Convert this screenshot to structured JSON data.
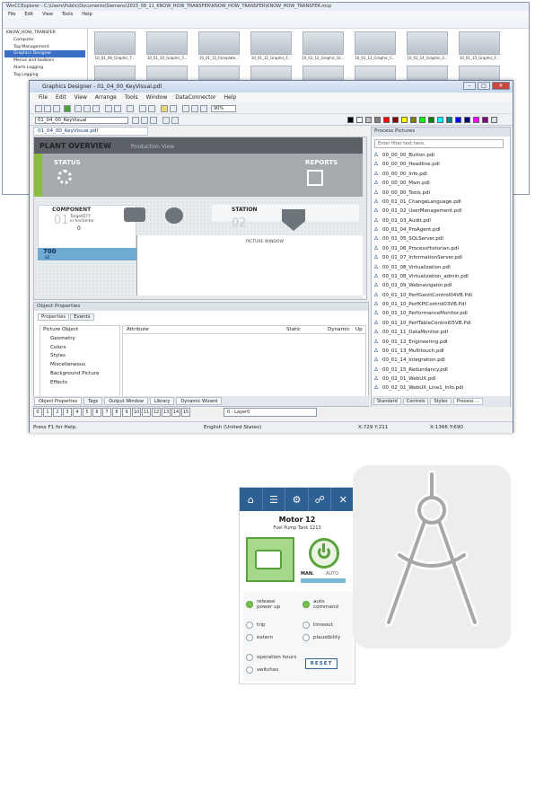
{
  "explorer": {
    "title": "WinCCExplorer - C:\\Users\\Public\\Documents\\Siemens\\2015_08_11_KNOW_HOW_TRANSFER\\KNOW_HOW_TRANSFER\\KNOW_HOW_TRANSFER.mcp",
    "menu": [
      "File",
      "Edit",
      "View",
      "Tools",
      "Help"
    ],
    "tree": [
      "KNOW_HOW_TRANSFER",
      "Computer",
      "Tag Management",
      "Graphics Designer",
      "Menus and toolbars",
      "Alarm Logging",
      "Tag Logging"
    ],
    "thumbs": [
      "10_01_09_Graphic_T...",
      "10_01_10_Graphic_F...",
      "10_01_11_Faceplate...",
      "10_01_11_Graphic_F...",
      "10_01_12_Graphic_Sc...",
      "10_01_13_Graphic_C...",
      "10_01_14_Graphic_3...",
      "10_01_15_Graphic_F..."
    ]
  },
  "designer": {
    "title": "Graphics Designer - 01_04_00_KeyVisual.pdl",
    "menu": [
      "File",
      "Edit",
      "View",
      "Arrange",
      "Tools",
      "Window",
      "DataConnector",
      "Help"
    ],
    "zoom": "90%",
    "object_name": "01_04_00_KeyVisual",
    "doc_tab": "01_04_00_KeyVisual.pdl",
    "swatch_colors": [
      "#000000",
      "#ffffff",
      "#c0c0c0",
      "#808080",
      "#ff0000",
      "#800000",
      "#ffff00",
      "#808000",
      "#00ff00",
      "#008000",
      "#00ffff",
      "#008080",
      "#0000ff",
      "#000080",
      "#ff00ff",
      "#800080",
      "#e0e0e0"
    ],
    "hmi": {
      "title": "PLANT OVERVIEW",
      "subtitle": "Production View",
      "status": "STATUS",
      "reports": "REPORTS",
      "component": "COMPONENT",
      "component_num": "01",
      "target_label_1": "TargetQTY",
      "target_label_2": "in hectoliter",
      "target_value": "0",
      "station": "STATION",
      "station_num": "02",
      "picture_window": "PICTURE WINDOW",
      "level_value": "700",
      "level_unit": "kB"
    },
    "process_pictures": {
      "title": "Process Pictures",
      "filter_placeholder": "Enter filter text here.",
      "items": [
        "00_00_00_Button.pdl",
        "00_00_00_Headline.pdl",
        "00_00_00_Info.pdl",
        "00_00_00_Main.pdl",
        "00_00_00_Tools.pdl",
        "00_01_01_ChangeLanguage.pdl",
        "00_01_02_UserManagement.pdl",
        "00_01_03_Audit.pdl",
        "00_01_04_ProAgent.pdl",
        "00_01_05_SQLServer.pdl",
        "00_01_06_ProcessHistorian.pdl",
        "00_01_07_InformationServer.pdl",
        "00_01_08_Virtualization.pdl",
        "00_01_08_Virtualization_admin.pdl",
        "00_01_09_Webnavigator.pdl",
        "00_01_10_PerfGanttControl04VB.Pdl",
        "00_01_10_PerfKPIControl03VB.Pdl",
        "00_01_10_PerformanceMonitor.pdl",
        "00_01_10_PerfTableControl05VB.Pdl",
        "00_01_11_DataMonitor.pdl",
        "00_01_12_Engineering.pdl",
        "00_01_13_Multitouch.pdl",
        "00_01_14_Integration.pdl",
        "00_01_15_Redundancy.pdl",
        "00_02_01_WebUX.pdl",
        "00_02_01_WebUX_Line1_Info.pdl"
      ],
      "tabs": [
        "Standard",
        "Controls",
        "Styles",
        "Process ..."
      ]
    },
    "object_properties": {
      "title": "Object Properties",
      "tabs": [
        "Properties",
        "Events"
      ],
      "root": "Picture Object",
      "children": [
        "Geometry",
        "Colors",
        "Styles",
        "Miscellaneous",
        "Background Picture",
        "Effects"
      ],
      "columns": [
        "Attribute",
        "Static",
        "Dynamic",
        "Up"
      ],
      "bottom_tabs": [
        "Object Properties",
        "Tags",
        "Output Window",
        "Library",
        "Dynamic Wizard"
      ]
    },
    "layers": [
      "0",
      "1",
      "2",
      "3",
      "4",
      "5",
      "6",
      "7",
      "8",
      "9",
      "10",
      "11",
      "12",
      "13",
      "14",
      "15"
    ],
    "layer_select": "0 - Layer0",
    "status": {
      "help": "Press F1 for Help.",
      "language": "English (United States)",
      "pos": "X:729 Y:211",
      "size": "X:1366 Y:690"
    }
  },
  "faceplate": {
    "title": "Motor 12",
    "subtitle": "Fuel Pump Tank 1213",
    "man": "MAN.",
    "auto": "AUTO",
    "release": "release\npower up",
    "auto_command": "auto\ncommand",
    "trip": "trip",
    "extern": "extern",
    "timeout": "timeout",
    "plausibility": "plausibility",
    "operation_hours": "operation hours",
    "switches": "switches",
    "reset": "RESET"
  }
}
